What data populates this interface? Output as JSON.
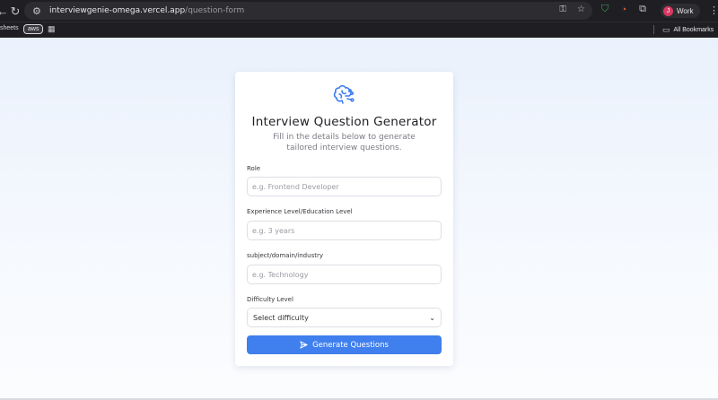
{
  "browser": {
    "url_host": "interviewgenie-omega.vercel.app",
    "url_path": "/question-form",
    "profile_initial": "J",
    "profile_name": "Work",
    "icons": {
      "back": "back-arrow-icon",
      "reload": "reload-icon",
      "site": "site-settings-icon",
      "key": "key-icon",
      "star": "star-icon",
      "shield": "shield-extension-icon",
      "rss": "rss-icon",
      "puzzle": "extensions-puzzle-icon",
      "kebab": "kebab-menu-icon"
    },
    "colors": {
      "chrome": "#1f1f23",
      "urlbar": "#2d2d31",
      "avatar": "#d93a63"
    }
  },
  "bookmarks": {
    "sheets": "sheets",
    "aws": "aws",
    "all": "All Bookmarks"
  },
  "form": {
    "title": "Interview Question Generator",
    "subtitle": "Fill in the details below to generate tailored interview questions.",
    "icon": "brain-icon",
    "fields": [
      {
        "label": "Role",
        "placeholder": "e.g. Frontend Developer"
      },
      {
        "label": "Experience Level/Education Level",
        "placeholder": "e.g. 3 years"
      },
      {
        "label": "subject/domain/industry",
        "placeholder": "e.g. Technology"
      }
    ],
    "difficulty": {
      "label": "Difficulty Level",
      "value": "Select difficulty"
    },
    "button": {
      "label": "Generate Questions",
      "icon": "send-icon"
    },
    "colors": {
      "accent": "#3f7fee",
      "card": "#ffffff"
    }
  }
}
